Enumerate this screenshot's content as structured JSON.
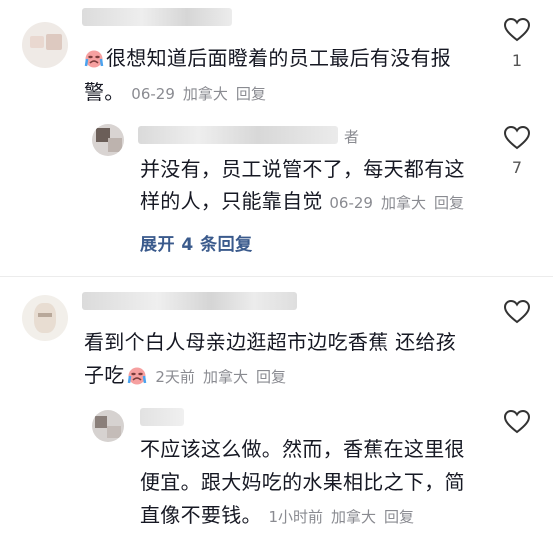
{
  "comments": [
    {
      "text": "很想知道后面瞪着的员工最后有没有报警。",
      "line1": "很想知道后面瞪着的员工最后有没有报",
      "line2": "警。",
      "date": "06-29",
      "location": "加拿大",
      "reply_label": "回复",
      "like_count": "1",
      "has_emoji": true,
      "reply": {
        "author_suffix": "者",
        "line1": "并没有，员工说管不了，每天都有这",
        "line2": "样的人，只能靠自觉",
        "date": "06-29",
        "location": "加拿大",
        "reply_label": "回复",
        "like_count": "7"
      },
      "expand_label": "展开 4 条回复"
    },
    {
      "line1": "看到个白人母亲边逛超市边吃香蕉 还给孩",
      "line2": "子吃",
      "date": "2天前",
      "location": "加拿大",
      "reply_label": "回复",
      "reply": {
        "line1": "不应该这么做。然而，香蕉在这里很",
        "line2": "便宜。跟大妈吃的水果相比之下，简",
        "line3": "直像不要钱。",
        "date": "1小时前",
        "location": "加拿大",
        "reply_label": "回复"
      }
    }
  ],
  "colors": {
    "text": "#161823",
    "meta": "#8a8b91",
    "link": "#3a5a8c"
  }
}
